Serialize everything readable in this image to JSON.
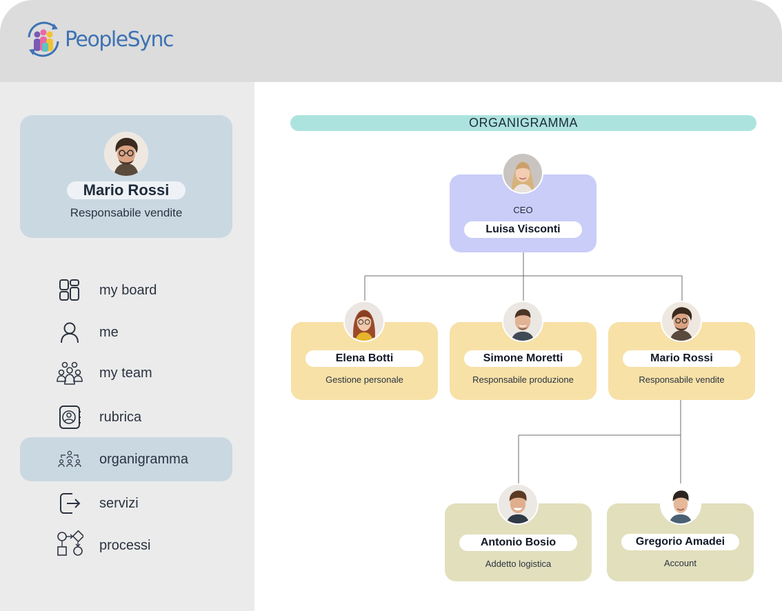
{
  "app": {
    "brand": "PeopleSync"
  },
  "user": {
    "name": "Mario Rossi",
    "role": "Responsabile vendite"
  },
  "nav": {
    "items": [
      {
        "label": "my board",
        "icon": "dashboard-icon"
      },
      {
        "label": "me",
        "icon": "user-icon"
      },
      {
        "label": "my team",
        "icon": "team-icon"
      },
      {
        "label": "rubrica",
        "icon": "contacts-book-icon"
      },
      {
        "label": "organigramma",
        "icon": "org-chart-icon",
        "active": true
      },
      {
        "label": "servizi",
        "icon": "exit-arrow-icon"
      },
      {
        "label": "processi",
        "icon": "process-flow-icon"
      }
    ]
  },
  "org": {
    "title": "ORGANIGRAMMA",
    "ceo": {
      "title": "CEO",
      "name": "Luisa Visconti"
    },
    "managers": [
      {
        "name": "Elena Botti",
        "role": "Gestione personale"
      },
      {
        "name": "Simone Moretti",
        "role": "Responsabile produzione"
      },
      {
        "name": "Mario Rossi",
        "role": "Responsabile vendite"
      }
    ],
    "staff": [
      {
        "name": "Antonio Bosio",
        "role": "Addetto logistica"
      },
      {
        "name": "Gregorio Amadei",
        "role": "Account"
      }
    ]
  },
  "colors": {
    "topbar": "#dcdcdc",
    "sidebar": "#ebebeb",
    "card_blue": "#cad8e2",
    "title_bar": "#ade3df",
    "ceo_box": "#c9cdf8",
    "manager_box": "#f7e1a7",
    "staff_box": "#e2dfbd",
    "brand_blue": "#3d72b4"
  }
}
